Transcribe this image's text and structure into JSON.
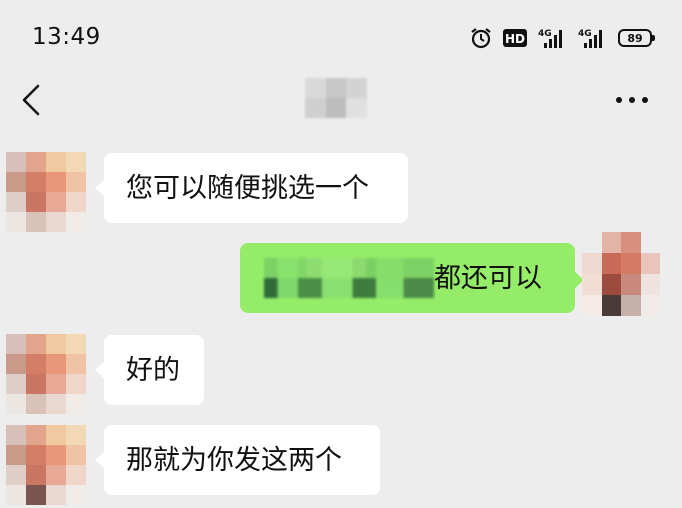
{
  "status_bar": {
    "time": "13:49",
    "icons": [
      "alarm-icon",
      "hd-icon",
      "signal-4g-icon",
      "signal-4g-icon",
      "battery-icon"
    ],
    "hd_label": "HD",
    "network_labels": [
      "4G",
      "4G"
    ],
    "battery_level": "89"
  },
  "nav": {
    "back_icon": "chevron-left-icon",
    "title_redacted": true,
    "more_icon": "more-dots-icon"
  },
  "messages": [
    {
      "side": "left",
      "text": "您可以随便挑选一个"
    },
    {
      "side": "right",
      "text_visible": "都还可以",
      "partially_redacted": true
    },
    {
      "side": "left",
      "text": "好的"
    },
    {
      "side": "left",
      "text": "那就为你发这两个"
    }
  ],
  "colors": {
    "background": "#ededed",
    "incoming_bubble": "#ffffff",
    "outgoing_bubble": "#95ec69"
  }
}
